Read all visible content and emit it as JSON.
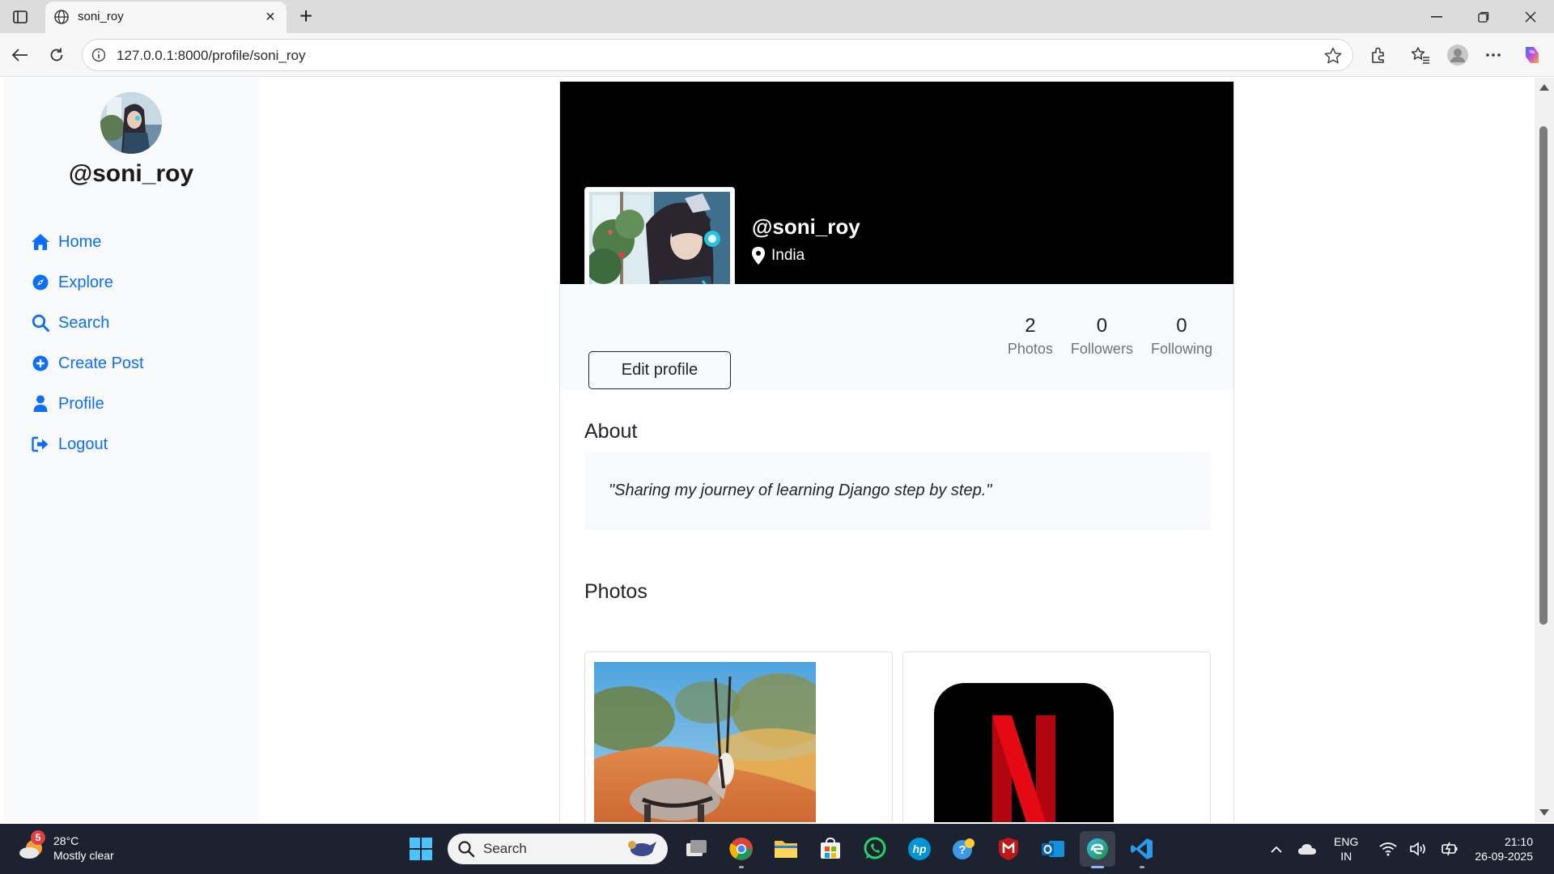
{
  "browser": {
    "tab_title": "soni_roy",
    "url": "127.0.0.1:8000/profile/soni_roy"
  },
  "sidebar": {
    "username": "@soni_roy",
    "items": [
      {
        "label": "Home",
        "icon": "home-icon"
      },
      {
        "label": "Explore",
        "icon": "compass-icon"
      },
      {
        "label": "Search",
        "icon": "search-icon"
      },
      {
        "label": "Create Post",
        "icon": "plus-circle-icon"
      },
      {
        "label": "Profile",
        "icon": "user-icon"
      },
      {
        "label": "Logout",
        "icon": "logout-icon"
      }
    ],
    "link_color": "#0d6efd"
  },
  "profile": {
    "username": "@soni_roy",
    "location": "India",
    "edit_label": "Edit profile",
    "stats": [
      {
        "value": "2",
        "label": "Photos"
      },
      {
        "value": "0",
        "label": "Followers"
      },
      {
        "value": "0",
        "label": "Following"
      }
    ],
    "about_heading": "About",
    "bio": "\"Sharing my journey of learning Django step by step.\"",
    "photos_heading": "Photos",
    "photos": [
      {
        "subject": "oryx antelope in desert"
      },
      {
        "subject": "netflix logo"
      }
    ]
  },
  "taskbar": {
    "weather_temp": "28°C",
    "weather_desc": "Mostly clear",
    "weather_badge": "5",
    "search_label": "Search",
    "lang_top": "ENG",
    "lang_bottom": "IN",
    "time": "21:10",
    "date": "26-09-2025"
  }
}
